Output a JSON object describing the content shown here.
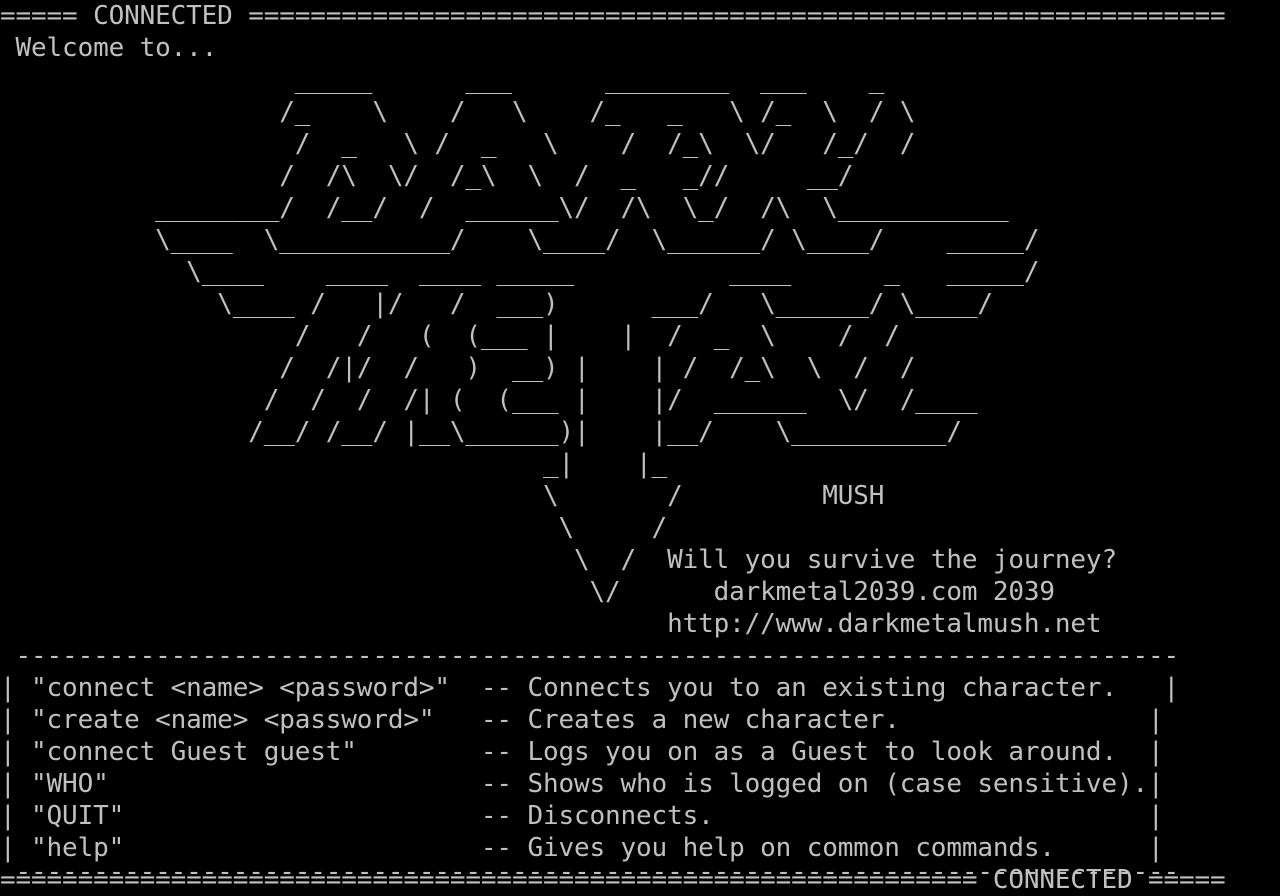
{
  "theme": {
    "background": "#000000",
    "foreground": "#c0c0c0"
  },
  "terminal": {
    "lines": [
      "===== CONNECTED ===============================================================",
      " Welcome to...",
      "                   _____      ___      ________  ___    _",
      "                  /_    \\    /   \\    /_   _   \\ /_  \\  / \\",
      "                   /  _   \\ /  _   \\    /  /_\\  \\/   /_/  /",
      "                  /  /\\  \\/  /_\\  \\  /  _   _//     __/",
      "          ________/  /__/  /  ______\\/  /\\  \\_/  /\\  \\___________",
      "          \\____  \\___________/    \\____/  \\______/ \\____/    _____/",
      "            \\____    ____  ____ _____          ____      _   _____/",
      "              \\____ /   |/   /  ___)      ___/   \\______/ \\____/",
      "                   /   /   (  (___ |    |  /  _  \\    /  /",
      "                  /  /|/  /   )  __) |    | /  /_\\  \\  /  /",
      "                 /  /  /  /| (  (___ |    |/  ______  \\/  /____",
      "                /__/ /__/ |__\\______)|    |__/    \\__________/",
      "                                   _|    |_",
      "                                   \\       /         MUSH",
      "                                    \\     /",
      "                                     \\  /  Will you survive the journey?",
      "                                      \\/      darkmetal2039.com 2039",
      "                                           http://www.darkmetalmush.net",
      " ---------------------------------------------------------------------------",
      "| \"connect <name> <password>\"  -- Connects you to an existing character.   |",
      "| \"create <name> <password>\"   -- Creates a new character.                |",
      "| \"connect Guest guest\"        -- Logs you on as a Guest to look around.  |",
      "| \"WHO\"                        -- Shows who is logged on (case sensitive).|",
      "| \"QUIT\"                       -- Disconnects.                            |",
      "| \"help\"                       -- Gives you help on common commands.      |",
      " ---------------------------------------------------------------------------",
      "=============================================================== CONNECTED ====="
    ]
  }
}
